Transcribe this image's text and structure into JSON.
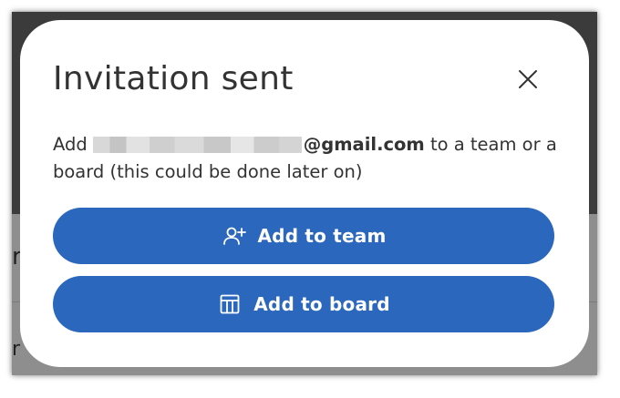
{
  "backdrop": {
    "partial_char_1": "r",
    "partial_char_2": "r"
  },
  "dialog": {
    "title": "Invitation sent",
    "close_icon": "close-icon",
    "message": {
      "prefix": "Add",
      "email_domain": "@gmail.com",
      "suffix": " to a team or a board (this could be done later on)"
    },
    "buttons": [
      {
        "label": "Add to team",
        "icon": "add-user-icon"
      },
      {
        "label": "Add to board",
        "icon": "board-icon"
      }
    ]
  },
  "colors": {
    "primary": "#2b67bd",
    "text": "#333333",
    "dialog_bg": "#ffffff"
  }
}
